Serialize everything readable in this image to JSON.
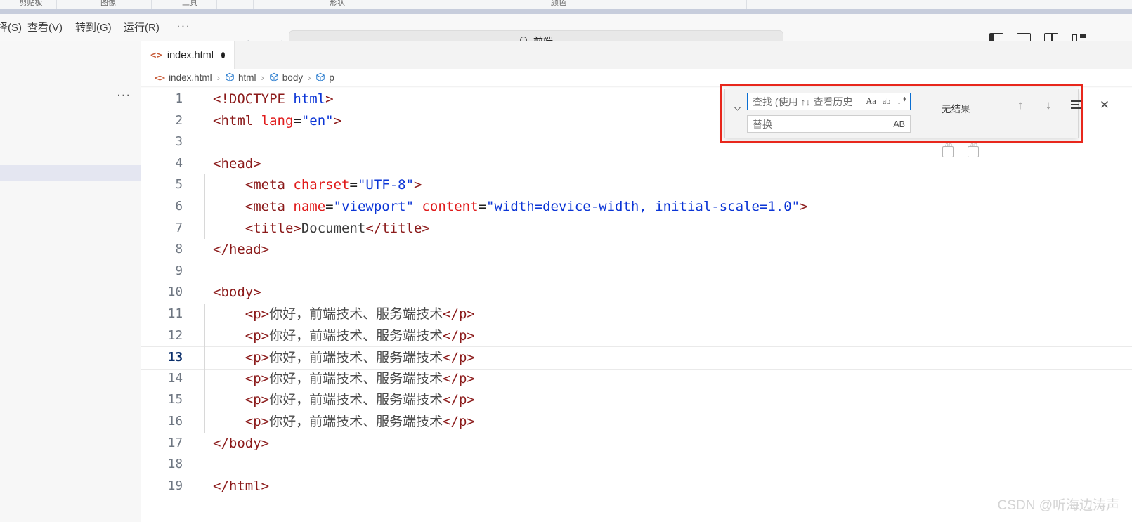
{
  "ribbon": {
    "labels": [
      "剪贴板",
      "图像",
      "工具",
      "形状",
      "颜色"
    ]
  },
  "menubar": {
    "items": [
      {
        "label": "择(S)"
      },
      {
        "label": "查看(V)"
      },
      {
        "label": "转到(G)"
      },
      {
        "label": "运行(R)"
      }
    ],
    "more_label": "···",
    "back_icon": "←",
    "forward_icon": "→"
  },
  "title_search": {
    "icon": "search-icon",
    "value": "前端"
  },
  "layout_toggles": [
    {
      "name": "toggle-primary-sidebar"
    },
    {
      "name": "toggle-panel"
    },
    {
      "name": "toggle-secondary-sidebar"
    },
    {
      "name": "customize-layout"
    }
  ],
  "sidebar": {
    "more_actions": "···"
  },
  "tabs": [
    {
      "icon": "html-file-icon",
      "label": "index.html",
      "dirty": true,
      "active": true
    }
  ],
  "breadcrumb": {
    "items": [
      {
        "icon": "html-file-icon",
        "label": "index.html"
      },
      {
        "icon": "symbol-cube-icon",
        "label": "html"
      },
      {
        "icon": "symbol-cube-icon",
        "label": "body"
      },
      {
        "icon": "symbol-cube-icon",
        "label": "p"
      }
    ],
    "separator": "›"
  },
  "find_widget": {
    "expand_icon": "chevron-down-icon",
    "find_placeholder": "查找 (使用 ↑↓ 查看历史",
    "match_case_label": "Aa",
    "whole_word_label": "ab",
    "regex_label": ".*",
    "status": "无结果",
    "prev_icon": "↑",
    "next_icon": "↓",
    "find_in_selection_icon": "find-in-selection-icon",
    "close_icon": "✕",
    "replace_placeholder": "替换",
    "preserve_case_label": "AB",
    "replace_icon": "replace-one-icon",
    "replace_all_icon": "replace-all-icon"
  },
  "editor": {
    "current_line": 13,
    "lines": [
      {
        "n": 1,
        "indent": 0,
        "tokens": [
          {
            "t": "tag",
            "s": "<!DOCTYPE "
          },
          {
            "t": "val",
            "s": "html"
          },
          {
            "t": "tag",
            "s": ">"
          }
        ]
      },
      {
        "n": 2,
        "indent": 0,
        "tokens": [
          {
            "t": "tag",
            "s": "<html "
          },
          {
            "t": "attr",
            "s": "lang"
          },
          {
            "t": "plain",
            "s": "="
          },
          {
            "t": "val",
            "s": "\"en\""
          },
          {
            "t": "tag",
            "s": ">"
          }
        ]
      },
      {
        "n": 3,
        "indent": 0,
        "tokens": []
      },
      {
        "n": 4,
        "indent": 0,
        "tokens": [
          {
            "t": "tag",
            "s": "<head>"
          }
        ]
      },
      {
        "n": 5,
        "indent": 1,
        "tokens": [
          {
            "t": "tag",
            "s": "<meta "
          },
          {
            "t": "attr",
            "s": "charset"
          },
          {
            "t": "plain",
            "s": "="
          },
          {
            "t": "val",
            "s": "\"UTF-8\""
          },
          {
            "t": "tag",
            "s": ">"
          }
        ]
      },
      {
        "n": 6,
        "indent": 1,
        "tokens": [
          {
            "t": "tag",
            "s": "<meta "
          },
          {
            "t": "attr",
            "s": "name"
          },
          {
            "t": "plain",
            "s": "="
          },
          {
            "t": "val",
            "s": "\"viewport\""
          },
          {
            "t": "plain",
            "s": " "
          },
          {
            "t": "attr",
            "s": "content"
          },
          {
            "t": "plain",
            "s": "="
          },
          {
            "t": "val",
            "s": "\"width=device-width, initial-scale=1.0\""
          },
          {
            "t": "tag",
            "s": ">"
          }
        ]
      },
      {
        "n": 7,
        "indent": 1,
        "tokens": [
          {
            "t": "tag",
            "s": "<title>"
          },
          {
            "t": "txt",
            "s": "Document"
          },
          {
            "t": "tag",
            "s": "</title>"
          }
        ]
      },
      {
        "n": 8,
        "indent": 0,
        "tokens": [
          {
            "t": "tag",
            "s": "</head>"
          }
        ]
      },
      {
        "n": 9,
        "indent": 0,
        "tokens": []
      },
      {
        "n": 10,
        "indent": 0,
        "tokens": [
          {
            "t": "tag",
            "s": "<body>"
          }
        ]
      },
      {
        "n": 11,
        "indent": 1,
        "tokens": [
          {
            "t": "tag",
            "s": "<p>"
          },
          {
            "t": "cn",
            "s": "你好，前端技术、服务端技术"
          },
          {
            "t": "tag",
            "s": "</p>"
          }
        ]
      },
      {
        "n": 12,
        "indent": 1,
        "tokens": [
          {
            "t": "tag",
            "s": "<p>"
          },
          {
            "t": "cn",
            "s": "你好，前端技术、服务端技术"
          },
          {
            "t": "tag",
            "s": "</p>"
          }
        ]
      },
      {
        "n": 13,
        "indent": 1,
        "tokens": [
          {
            "t": "tag",
            "s": "<p>"
          },
          {
            "t": "cn",
            "s": "你好，前端技术、服务端技术"
          },
          {
            "t": "tag",
            "s": "</p>"
          }
        ]
      },
      {
        "n": 14,
        "indent": 1,
        "tokens": [
          {
            "t": "tag",
            "s": "<p>"
          },
          {
            "t": "cn",
            "s": "你好，前端技术、服务端技术"
          },
          {
            "t": "tag",
            "s": "</p>"
          }
        ]
      },
      {
        "n": 15,
        "indent": 1,
        "tokens": [
          {
            "t": "tag",
            "s": "<p>"
          },
          {
            "t": "cn",
            "s": "你好，前端技术、服务端技术"
          },
          {
            "t": "tag",
            "s": "</p>"
          }
        ]
      },
      {
        "n": 16,
        "indent": 1,
        "tokens": [
          {
            "t": "tag",
            "s": "<p>"
          },
          {
            "t": "cn",
            "s": "你好，前端技术、服务端技术"
          },
          {
            "t": "tag",
            "s": "</p>"
          }
        ]
      },
      {
        "n": 17,
        "indent": 0,
        "tokens": [
          {
            "t": "tag",
            "s": "</body>"
          }
        ]
      },
      {
        "n": 18,
        "indent": 0,
        "tokens": []
      },
      {
        "n": 19,
        "indent": 0,
        "tokens": [
          {
            "t": "tag",
            "s": "</html>"
          }
        ]
      }
    ]
  },
  "watermark": {
    "text": "CSDN @听海边涛声"
  },
  "colors": {
    "accent": "#1766c9",
    "tag": "#8b1a1a",
    "attribute": "#e01b1b",
    "value": "#0b35d6",
    "find_highlight_border": "#e8271c",
    "find_input_focus": "#0a6ed1",
    "sidebar_selected": "#e4e6f1"
  }
}
